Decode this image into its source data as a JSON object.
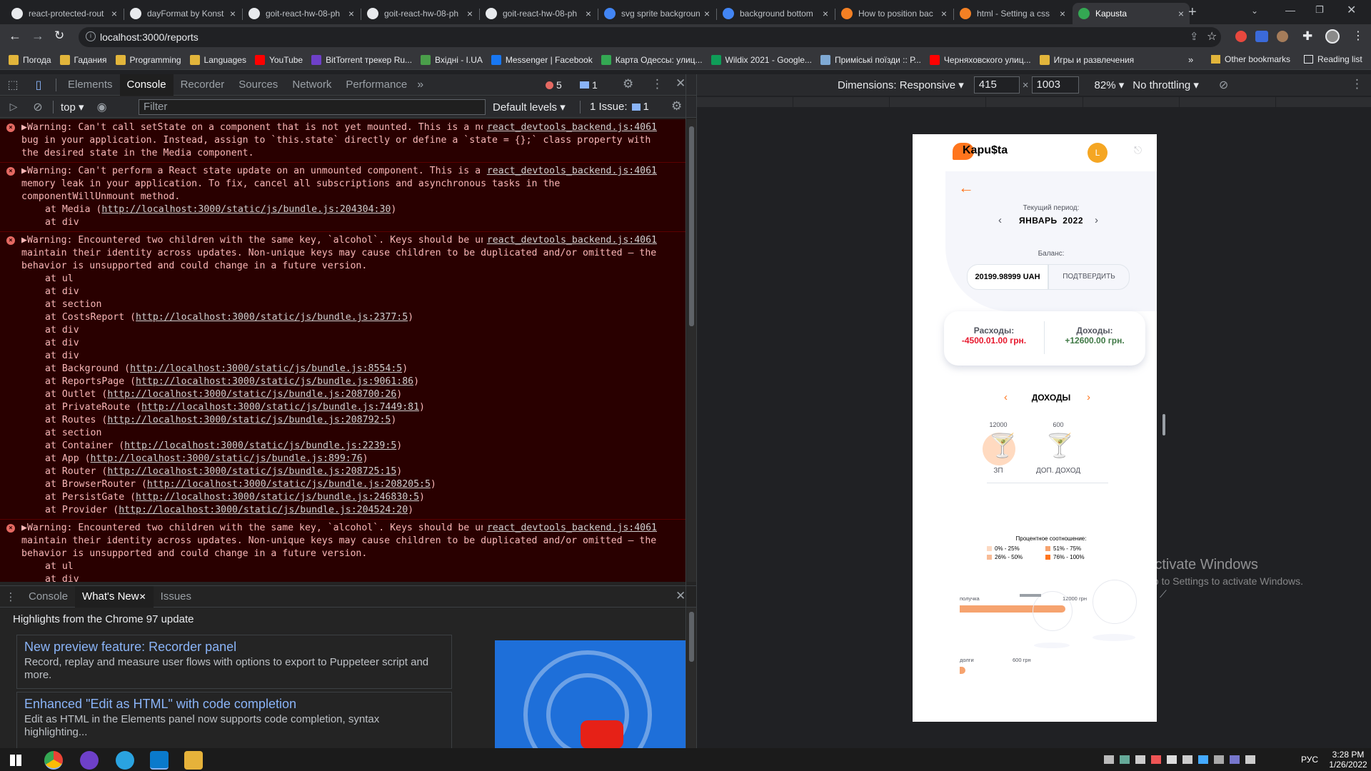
{
  "browser": {
    "tabs": [
      {
        "title": "react-protected-rout",
        "favicon": "github-icon"
      },
      {
        "title": "dayFormat by Konst",
        "favicon": "github-icon"
      },
      {
        "title": "goit-react-hw-08-ph",
        "favicon": "github-icon"
      },
      {
        "title": "goit-react-hw-08-ph",
        "favicon": "github-icon"
      },
      {
        "title": "goit-react-hw-08-ph",
        "favicon": "github-icon"
      },
      {
        "title": "svg sprite backgroun",
        "favicon": "google-icon"
      },
      {
        "title": "background bottom",
        "favicon": "google-icon"
      },
      {
        "title": "How to position bac",
        "favicon": "stackoverflow-icon"
      },
      {
        "title": "html - Setting a css",
        "favicon": "stackoverflow-icon"
      },
      {
        "title": "Kapusta",
        "favicon": "kapusta-icon",
        "active": true
      }
    ],
    "new_tab": "+",
    "url": "localhost:3000/reports",
    "bookmarks": [
      "Погода",
      "Гадания",
      "Programming",
      "Languages",
      "YouTube",
      "BitTorrent трекер Ru...",
      "Вхідні - I.UA",
      "Messenger | Facebook",
      "Карта Одессы: улиц...",
      "Wildix 2021 - Google...",
      "Приміські поїзди :: Р...",
      "Черняховского улиц...",
      "Игры и развлечения"
    ],
    "bookmarks_more": "»",
    "other_bookmarks": "Other bookmarks",
    "reading_list": "Reading list"
  },
  "devtools": {
    "tabs": [
      "Elements",
      "Console",
      "Recorder",
      "Sources",
      "Network",
      "Performance"
    ],
    "more": "»",
    "errors_count": "5",
    "messages_count": "1",
    "context": "top",
    "filter_placeholder": "Filter",
    "levels": "Default levels",
    "issues": "1 Issue:",
    "issues_count": "1",
    "messages": [
      {
        "text": "▶Warning: Can't call setState on a component that is not yet mounted. This is a no-op, but it might indicate a bug in your application. Instead, assign to `this.state` directly or define a `state = {};` class property with the desired state in the Media component.",
        "source": "react_devtools_backend.js:4061",
        "stack": []
      },
      {
        "text": "▶Warning: Can't perform a React state update on an unmounted component. This is a no-op, but it indicates a memory leak in your application. To fix, cancel all subscriptions and asynchronous tasks in the componentWillUnmount method.",
        "source": "react_devtools_backend.js:4061",
        "stack": [
          {
            "fn": "at Media (",
            "link": "http://localhost:3000/static/js/bundle.js:204304:30",
            "end": ")"
          },
          {
            "fn": "at div",
            "link": "",
            "end": ""
          }
        ]
      },
      {
        "text": "▶Warning: Encountered two children with the same key, `alcohol`. Keys should be unique so that components maintain their identity across updates. Non-unique keys may cause children to be duplicated and/or omitted — the behavior is unsupported and could change in a future version.",
        "source": "react_devtools_backend.js:4061",
        "stack": [
          {
            "fn": "at ul",
            "link": "",
            "end": ""
          },
          {
            "fn": "at div",
            "link": "",
            "end": ""
          },
          {
            "fn": "at section",
            "link": "",
            "end": ""
          },
          {
            "fn": "at CostsReport (",
            "link": "http://localhost:3000/static/js/bundle.js:2377:5",
            "end": ")"
          },
          {
            "fn": "at div",
            "link": "",
            "end": ""
          },
          {
            "fn": "at div",
            "link": "",
            "end": ""
          },
          {
            "fn": "at div",
            "link": "",
            "end": ""
          },
          {
            "fn": "at Background (",
            "link": "http://localhost:3000/static/js/bundle.js:8554:5",
            "end": ")"
          },
          {
            "fn": "at ReportsPage (",
            "link": "http://localhost:3000/static/js/bundle.js:9061:86",
            "end": ")"
          },
          {
            "fn": "at Outlet (",
            "link": "http://localhost:3000/static/js/bundle.js:208700:26",
            "end": ")"
          },
          {
            "fn": "at PrivateRoute (",
            "link": "http://localhost:3000/static/js/bundle.js:7449:81",
            "end": ")"
          },
          {
            "fn": "at Routes (",
            "link": "http://localhost:3000/static/js/bundle.js:208792:5",
            "end": ")"
          },
          {
            "fn": "at section",
            "link": "",
            "end": ""
          },
          {
            "fn": "at Container (",
            "link": "http://localhost:3000/static/js/bundle.js:2239:5",
            "end": ")"
          },
          {
            "fn": "at App (",
            "link": "http://localhost:3000/static/js/bundle.js:899:76",
            "end": ")"
          },
          {
            "fn": "at Router (",
            "link": "http://localhost:3000/static/js/bundle.js:208725:15",
            "end": ")"
          },
          {
            "fn": "at BrowserRouter (",
            "link": "http://localhost:3000/static/js/bundle.js:208205:5",
            "end": ")"
          },
          {
            "fn": "at PersistGate (",
            "link": "http://localhost:3000/static/js/bundle.js:246830:5",
            "end": ")"
          },
          {
            "fn": "at Provider (",
            "link": "http://localhost:3000/static/js/bundle.js:204524:20",
            "end": ")"
          }
        ]
      },
      {
        "text": "▶Warning: Encountered two children with the same key, `alcohol`. Keys should be unique so that components maintain their identity across updates. Non-unique keys may cause children to be duplicated and/or omitted — the behavior is unsupported and could change in a future version.",
        "source": "react_devtools_backend.js:4061",
        "stack": [
          {
            "fn": "at ul",
            "link": "",
            "end": ""
          },
          {
            "fn": "at div",
            "link": "",
            "end": ""
          }
        ]
      }
    ],
    "drawer": {
      "tabs": [
        "Console",
        "What's New",
        "Issues"
      ],
      "heading": "Highlights from the Chrome 97 update",
      "cards": [
        {
          "title": "New preview feature: Recorder panel",
          "body": "Record, replay and measure user flows with options to export to Puppeteer script and more."
        },
        {
          "title": "Enhanced \"Edit as HTML\" with code completion",
          "body": "Edit as HTML in the Elements panel now supports code completion, syntax highlighting..."
        }
      ]
    }
  },
  "emulation": {
    "dimensions": "Dimensions: Responsive",
    "width": "415",
    "times": "×",
    "height": "1003",
    "zoom": "82%",
    "throttling": "No throttling"
  },
  "app": {
    "logo": "Kapu$ta",
    "avatar_letter": "L",
    "period_label": "Текущий период:",
    "period_value": "ЯНВАРЬ  2022",
    "balance_label": "Баланс:",
    "balance_value": "20199.98999 UAH",
    "confirm_button": "ПОДТВЕРДИТЬ",
    "expenses_label": "Расходы:",
    "expenses_value": "-4500.01.00 грн.",
    "income_label": "Доходы:",
    "income_value": "+12600.00 грн.",
    "category_title": "ДОХОДЫ",
    "categories": [
      {
        "amount": "12000",
        "name": "ЗП"
      },
      {
        "amount": "600",
        "name": "ДОП. ДОХОД"
      }
    ],
    "legend_title": "Процентное соотношение:",
    "legend": [
      {
        "label": "0% - 25%",
        "color": "#fcd9c2"
      },
      {
        "label": "51% - 75%",
        "color": "#f6a36f"
      },
      {
        "label": "26% - 50%",
        "color": "#f8bb95"
      },
      {
        "label": "76% - 100%",
        "color": "#ff751d"
      }
    ],
    "bars": [
      {
        "label": "получка",
        "value_label": "12000 грн",
        "fraction": 0.95
      },
      {
        "label": "долги",
        "value_label": "600 грн",
        "fraction": 0.05
      }
    ],
    "colors": {
      "accent": "#ff751d",
      "expense": "#e7192e",
      "income": "#407946"
    }
  },
  "watermark": {
    "title": "Activate Windows",
    "subtitle": "Go to Settings to activate Windows."
  },
  "taskbar": {
    "lang": "РУС",
    "time": "3:28 PM",
    "date": "1/26/2022"
  }
}
